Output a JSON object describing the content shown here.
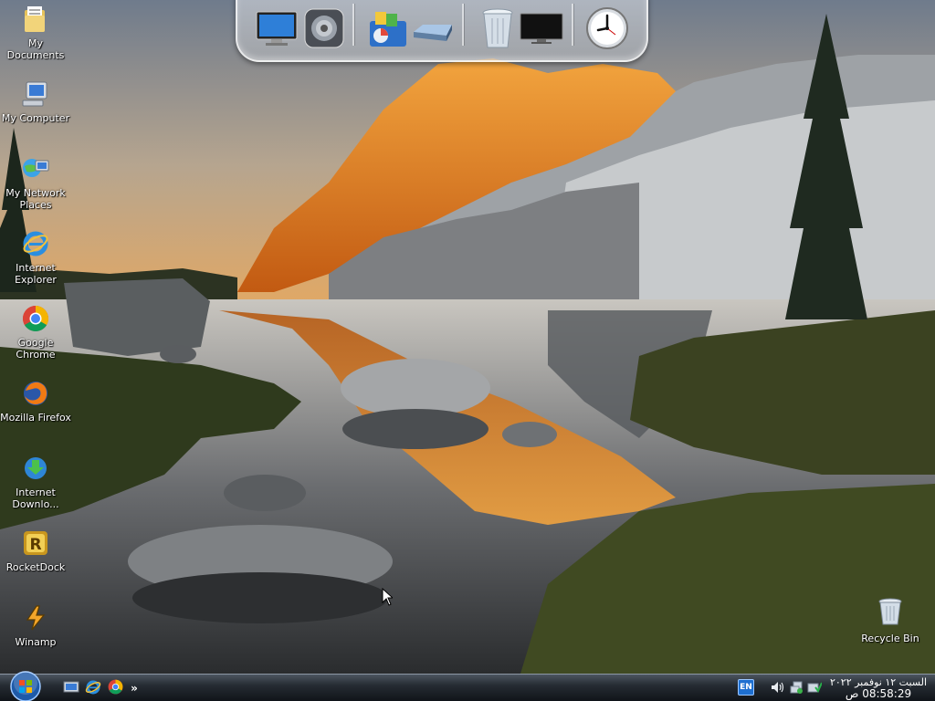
{
  "desktop": {
    "icons": [
      {
        "label": "My Documents",
        "icon": "folder-icon"
      },
      {
        "label": "My Computer",
        "icon": "computer-icon"
      },
      {
        "label": "My Network Places",
        "icon": "network-icon"
      },
      {
        "label": "Internet Explorer",
        "icon": "internet-explorer-icon"
      },
      {
        "label": "Google Chrome",
        "icon": "chrome-icon"
      },
      {
        "label": "Mozilla Firefox",
        "icon": "firefox-icon"
      },
      {
        "label": "Internet Downlo...",
        "icon": "download-manager-icon"
      },
      {
        "label": "RocketDock",
        "icon": "rocketdock-icon"
      },
      {
        "label": "Winamp",
        "icon": "winamp-icon"
      }
    ],
    "recycle_bin": {
      "label": "Recycle Bin",
      "icon": "recycle-bin-icon"
    }
  },
  "dock": {
    "items": [
      "monitor-icon",
      "settings-gear-icon",
      "photo-gallery-icon",
      "drive-icon",
      "trash-icon",
      "display-icon",
      "clock-icon"
    ]
  },
  "taskbar": {
    "start": {
      "icon": "windows-logo-icon"
    },
    "quick_launch": [
      "show-desktop-icon",
      "internet-explorer-icon",
      "chrome-icon"
    ],
    "more": "»",
    "language": "EN",
    "tray": [
      "volume-icon",
      "network-tray-icon",
      "safely-remove-icon"
    ],
    "clock": {
      "date": "السبت ١٢ نوفمبر ٢٠٢٢",
      "time": "08:58:29 ص"
    }
  },
  "colors": {
    "taskbar": "#1a1f26",
    "accent": "#1e6fd0"
  }
}
